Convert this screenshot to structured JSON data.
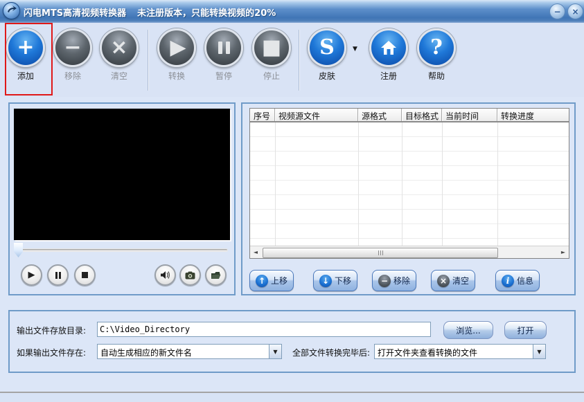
{
  "window": {
    "title_brand": "闪电MTS高清视频转换器",
    "title_notice": "未注册版本，只能转换视频的20%",
    "minimize_glyph": "−",
    "close_glyph": "×"
  },
  "colors": {
    "enabled_ball": "#1f78d8",
    "disabled_ball": "#5d656c",
    "annotation": "#e01818",
    "panel_border": "#6f9bc8",
    "titlebar": "#4076b6"
  },
  "toolbar": {
    "items": [
      {
        "label": "添加",
        "glyph": "+",
        "state": "enabled",
        "highlighted": true
      },
      {
        "label": "移除",
        "glyph": "−",
        "state": "disabled"
      },
      {
        "label": "清空",
        "glyph": "×",
        "state": "disabled"
      },
      {
        "label": "转换",
        "glyph": "▶",
        "state": "disabled"
      },
      {
        "label": "暂停",
        "glyph": "pause-bars",
        "state": "disabled"
      },
      {
        "label": "停止",
        "glyph": "■",
        "state": "disabled"
      },
      {
        "label": "皮肤",
        "glyph": "S",
        "state": "enabled",
        "has_dropdown": true
      },
      {
        "label": "注册",
        "glyph": "home",
        "state": "enabled"
      },
      {
        "label": "帮助",
        "glyph": "?",
        "state": "enabled"
      }
    ],
    "skin_dropdown_glyph": "▼"
  },
  "player": {
    "seek_position_percent": 0,
    "controls": [
      "play",
      "pause",
      "stop",
      "volume",
      "snapshot",
      "folder"
    ]
  },
  "file_list": {
    "columns": [
      "序号",
      "视频源文件",
      "源格式",
      "目标格式",
      "当前时间",
      "转换进度"
    ],
    "rows": [],
    "scroll_left_glyph": "◄",
    "scroll_right_glyph": "►"
  },
  "list_actions": [
    {
      "label": "上移",
      "glyph": "↑",
      "ball": "blue"
    },
    {
      "label": "下移",
      "glyph": "↓",
      "ball": "blue"
    },
    {
      "label": "移除",
      "glyph": "−",
      "ball": "gray"
    },
    {
      "label": "清空",
      "glyph": "×",
      "ball": "gray"
    },
    {
      "label": "信息",
      "glyph": "i",
      "ball": "blue"
    }
  ],
  "output": {
    "dir_label": "输出文件存放目录:",
    "dir_value": "C:\\Video_Directory",
    "browse_label": "浏览...",
    "open_label": "打开",
    "exists_label": "如果输出文件存在:",
    "exists_selected": "自动生成相应的新文件名",
    "after_label": "全部文件转换完毕后:",
    "after_selected": "打开文件夹查看转换的文件",
    "combo_arrow_glyph": "▼"
  }
}
